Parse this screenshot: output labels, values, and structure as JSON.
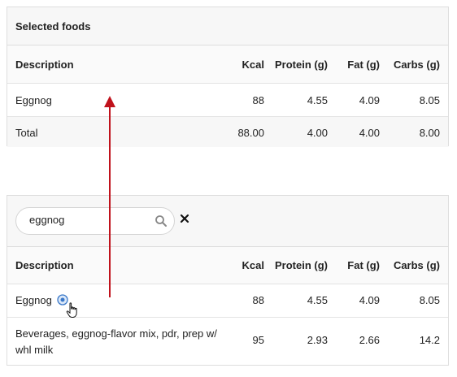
{
  "selected": {
    "title": "Selected foods",
    "columns": [
      "Description",
      "Kcal",
      "Protein (g)",
      "Fat (g)",
      "Carbs (g)"
    ],
    "rows": [
      {
        "description": "Eggnog",
        "kcal": "88",
        "protein": "4.55",
        "fat": "4.09",
        "carbs": "8.05"
      }
    ],
    "total": {
      "label": "Total",
      "kcal": "88.00",
      "protein": "4.00",
      "fat": "4.00",
      "carbs": "8.00"
    }
  },
  "search": {
    "query": "eggnog",
    "search_icon": "magnifier-icon",
    "clear_icon": "close-x-icon",
    "columns": [
      "Description",
      "Kcal",
      "Protein (g)",
      "Fat (g)",
      "Carbs (g)"
    ],
    "results": [
      {
        "description": "Eggnog",
        "kcal": "88",
        "protein": "4.55",
        "fat": "4.09",
        "carbs": "8.05",
        "action_icon": "add-circle-icon"
      },
      {
        "description_line1": "Beverages, eggnog-flavor mix, pdr, prep w/",
        "description_line2": "whl milk",
        "kcal": "95",
        "protein": "2.93",
        "fat": "2.66",
        "carbs": "14.2"
      }
    ]
  },
  "colors": {
    "arrow": "#c0121c",
    "border": "#dedede",
    "header_bg": "#f7f7f7",
    "add_icon": "#3a78c9"
  }
}
